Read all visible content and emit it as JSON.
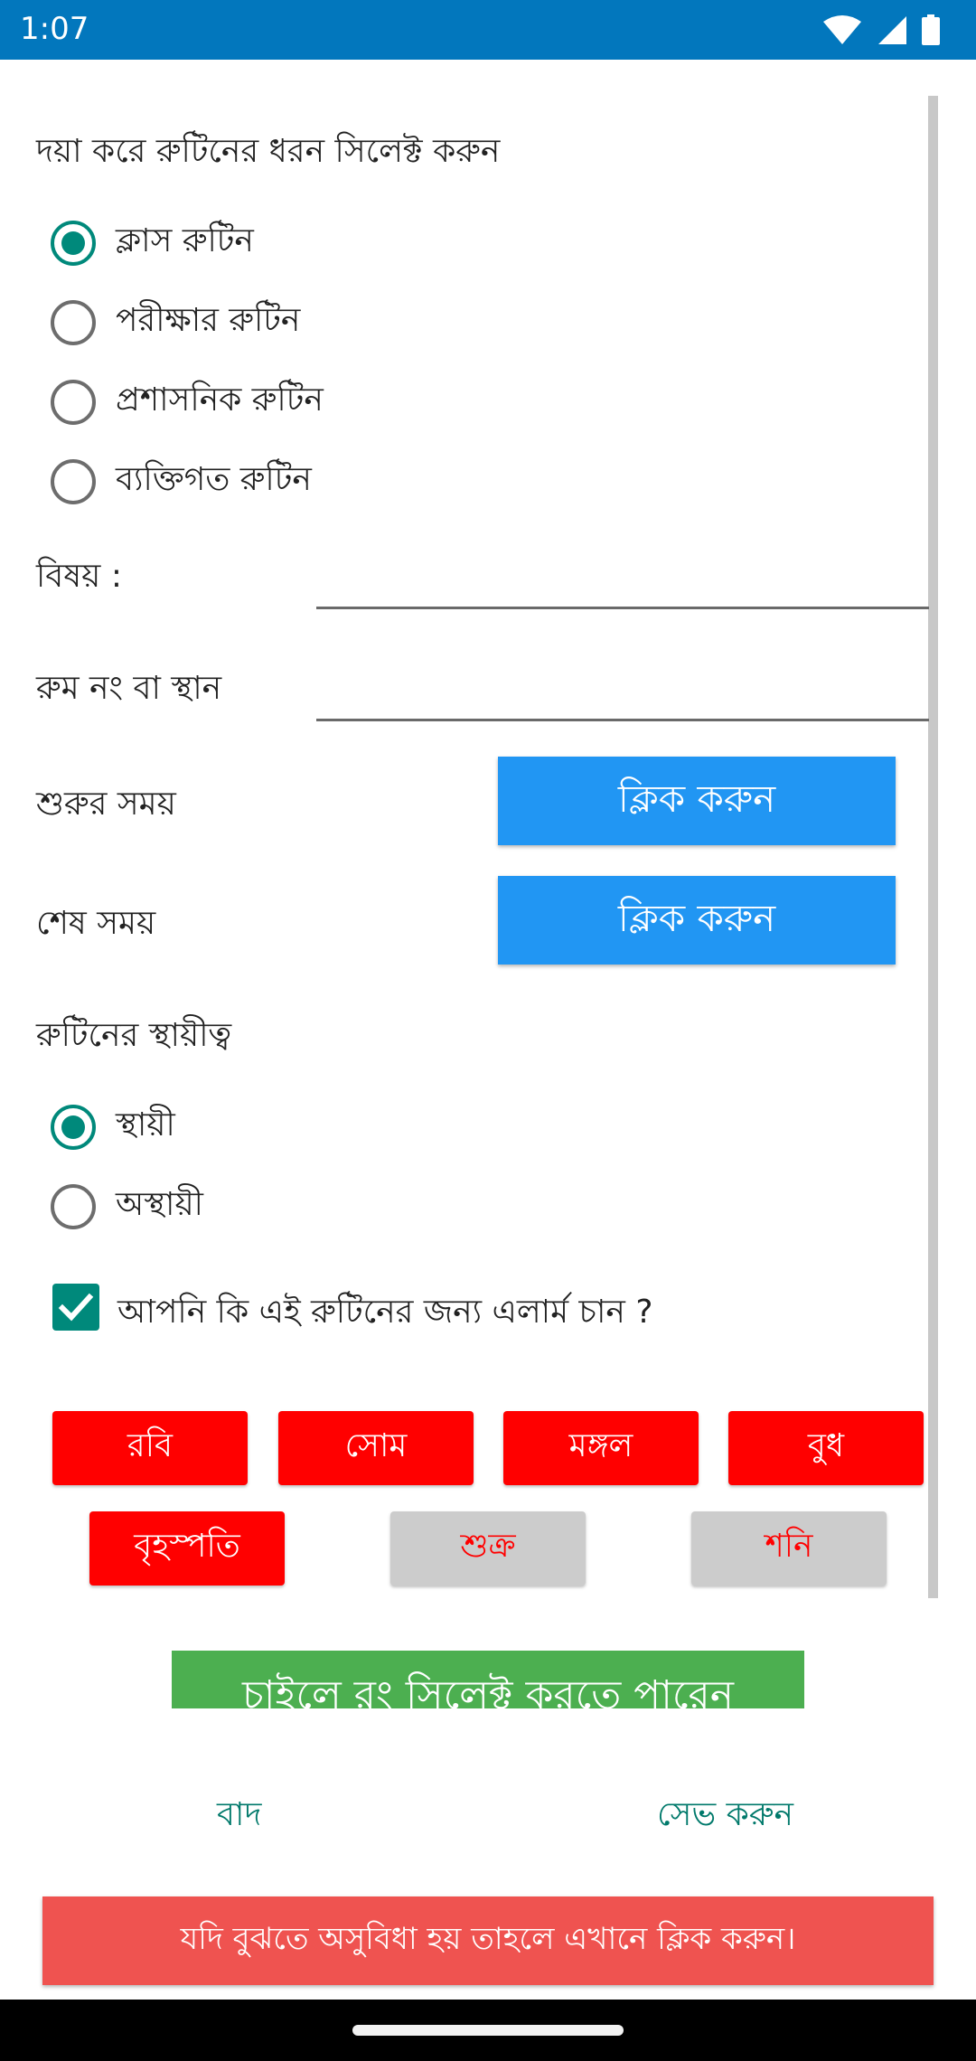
{
  "status_bar": {
    "time": "1:07"
  },
  "routine_type": {
    "prompt": "দয়া করে রুটিনের ধরন সিলেক্ট করুন",
    "options": [
      {
        "label": "ক্লাস রুটিন",
        "selected": true
      },
      {
        "label": "পরীক্ষার রুটিন",
        "selected": false
      },
      {
        "label": "প্রশাসনিক রুটিন",
        "selected": false
      },
      {
        "label": "ব্যক্তিগত রুটিন",
        "selected": false
      }
    ]
  },
  "fields": {
    "subject_label": "বিষয় :",
    "subject_value": "",
    "room_label": "রুম নং বা স্থান",
    "room_value": ""
  },
  "time": {
    "start_label": "শুরুর সময়",
    "start_button": "ক্লিক করুন",
    "end_label": "শেষ সময়",
    "end_button": "ক্লিক করুন"
  },
  "permanence": {
    "label": "রুটিনের স্থায়ীত্ব",
    "options": [
      {
        "label": "স্থায়ী",
        "selected": true
      },
      {
        "label": "অস্থায়ী",
        "selected": false
      }
    ]
  },
  "alarm": {
    "label": "আপনি কি এই রুটিনের জন্য এলার্ম চান ?",
    "checked": true
  },
  "days": [
    {
      "label": "রবি",
      "active": true
    },
    {
      "label": "সোম",
      "active": true
    },
    {
      "label": "মঙ্গল",
      "active": true
    },
    {
      "label": "বুধ",
      "active": true
    },
    {
      "label": "বৃহস্পতি",
      "active": true
    },
    {
      "label": "শুক্র",
      "active": false
    },
    {
      "label": "শনি",
      "active": false
    }
  ],
  "color_button": "চাইলে রং সিলেক্ট করতে পারেন",
  "actions": {
    "cancel": "বাদ",
    "save": "সেভ করুন"
  },
  "help_button": "যদি বুঝতে অসুবিধা হয় তাহলে এখানে ক্লিক করুন।",
  "colors": {
    "status_bar": "#0277bd",
    "accent": "#00897b",
    "blue_button": "#2196f3",
    "day_active": "#ff0000",
    "day_inactive": "#cccccc",
    "green_button": "#4caf50",
    "help_button": "#ef5350"
  }
}
